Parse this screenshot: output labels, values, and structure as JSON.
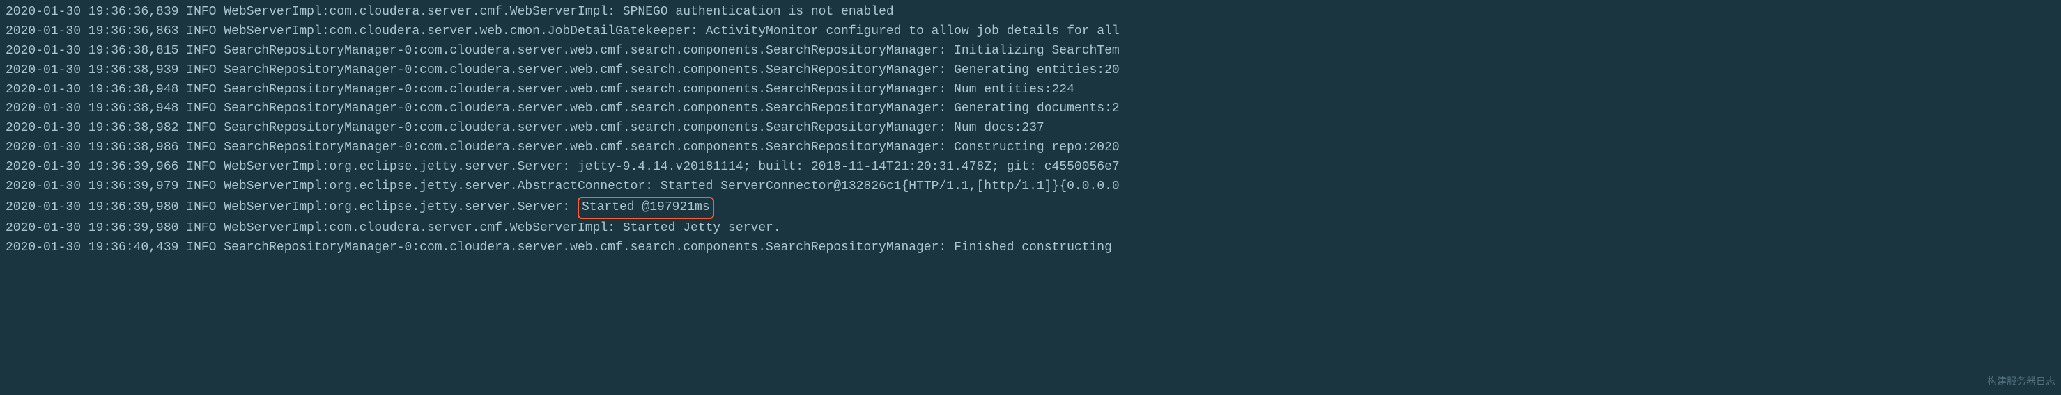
{
  "logs": [
    {
      "timestamp": "2020-01-30 19:36:36,839",
      "level": "INFO",
      "source": "WebServerImpl:com.cloudera.server.cmf.WebServerImpl:",
      "message": "SPNEGO authentication is not enabled"
    },
    {
      "timestamp": "2020-01-30 19:36:36,863",
      "level": "INFO",
      "source": "WebServerImpl:com.cloudera.server.web.cmon.JobDetailGatekeeper:",
      "message": "ActivityMonitor configured to allow job details for all"
    },
    {
      "timestamp": "2020-01-30 19:36:38,815",
      "level": "INFO",
      "source": "SearchRepositoryManager-0:com.cloudera.server.web.cmf.search.components.SearchRepositoryManager:",
      "message": "Initializing SearchTem"
    },
    {
      "timestamp": "2020-01-30 19:36:38,939",
      "level": "INFO",
      "source": "SearchRepositoryManager-0:com.cloudera.server.web.cmf.search.components.SearchRepositoryManager:",
      "message": "Generating entities:20"
    },
    {
      "timestamp": "2020-01-30 19:36:38,948",
      "level": "INFO",
      "source": "SearchRepositoryManager-0:com.cloudera.server.web.cmf.search.components.SearchRepositoryManager:",
      "message": "Num entities:224"
    },
    {
      "timestamp": "2020-01-30 19:36:38,948",
      "level": "INFO",
      "source": "SearchRepositoryManager-0:com.cloudera.server.web.cmf.search.components.SearchRepositoryManager:",
      "message": "Generating documents:2"
    },
    {
      "timestamp": "2020-01-30 19:36:38,982",
      "level": "INFO",
      "source": "SearchRepositoryManager-0:com.cloudera.server.web.cmf.search.components.SearchRepositoryManager:",
      "message": "Num docs:237"
    },
    {
      "timestamp": "2020-01-30 19:36:38,986",
      "level": "INFO",
      "source": "SearchRepositoryManager-0:com.cloudera.server.web.cmf.search.components.SearchRepositoryManager:",
      "message": "Constructing repo:2020"
    },
    {
      "timestamp": "2020-01-30 19:36:39,966",
      "level": "INFO",
      "source": "WebServerImpl:org.eclipse.jetty.server.Server:",
      "message": "jetty-9.4.14.v20181114; built: 2018-11-14T21:20:31.478Z; git: c4550056e7"
    },
    {
      "timestamp": "2020-01-30 19:36:39,979",
      "level": "INFO",
      "source": "WebServerImpl:org.eclipse.jetty.server.AbstractConnector:",
      "message": "Started ServerConnector@132826c1{HTTP/1.1,[http/1.1]}{0.0.0.0"
    },
    {
      "timestamp": "2020-01-30 19:36:39,980",
      "level": "INFO",
      "source": "WebServerImpl:org.eclipse.jetty.server.Server:",
      "message": "Started @197921ms",
      "highlighted": true
    },
    {
      "timestamp": "2020-01-30 19:36:39,980",
      "level": "INFO",
      "source": "WebServerImpl:com.cloudera.server.cmf.WebServerImpl:",
      "message": "Started Jetty server."
    },
    {
      "timestamp": "2020-01-30 19:36:40,439",
      "level": "INFO",
      "source": "SearchRepositoryManager-0:com.cloudera.server.web.cmf.search.components.SearchRepositoryManager:",
      "message": "Finished constructing"
    }
  ],
  "watermark": "构建服务器日志"
}
